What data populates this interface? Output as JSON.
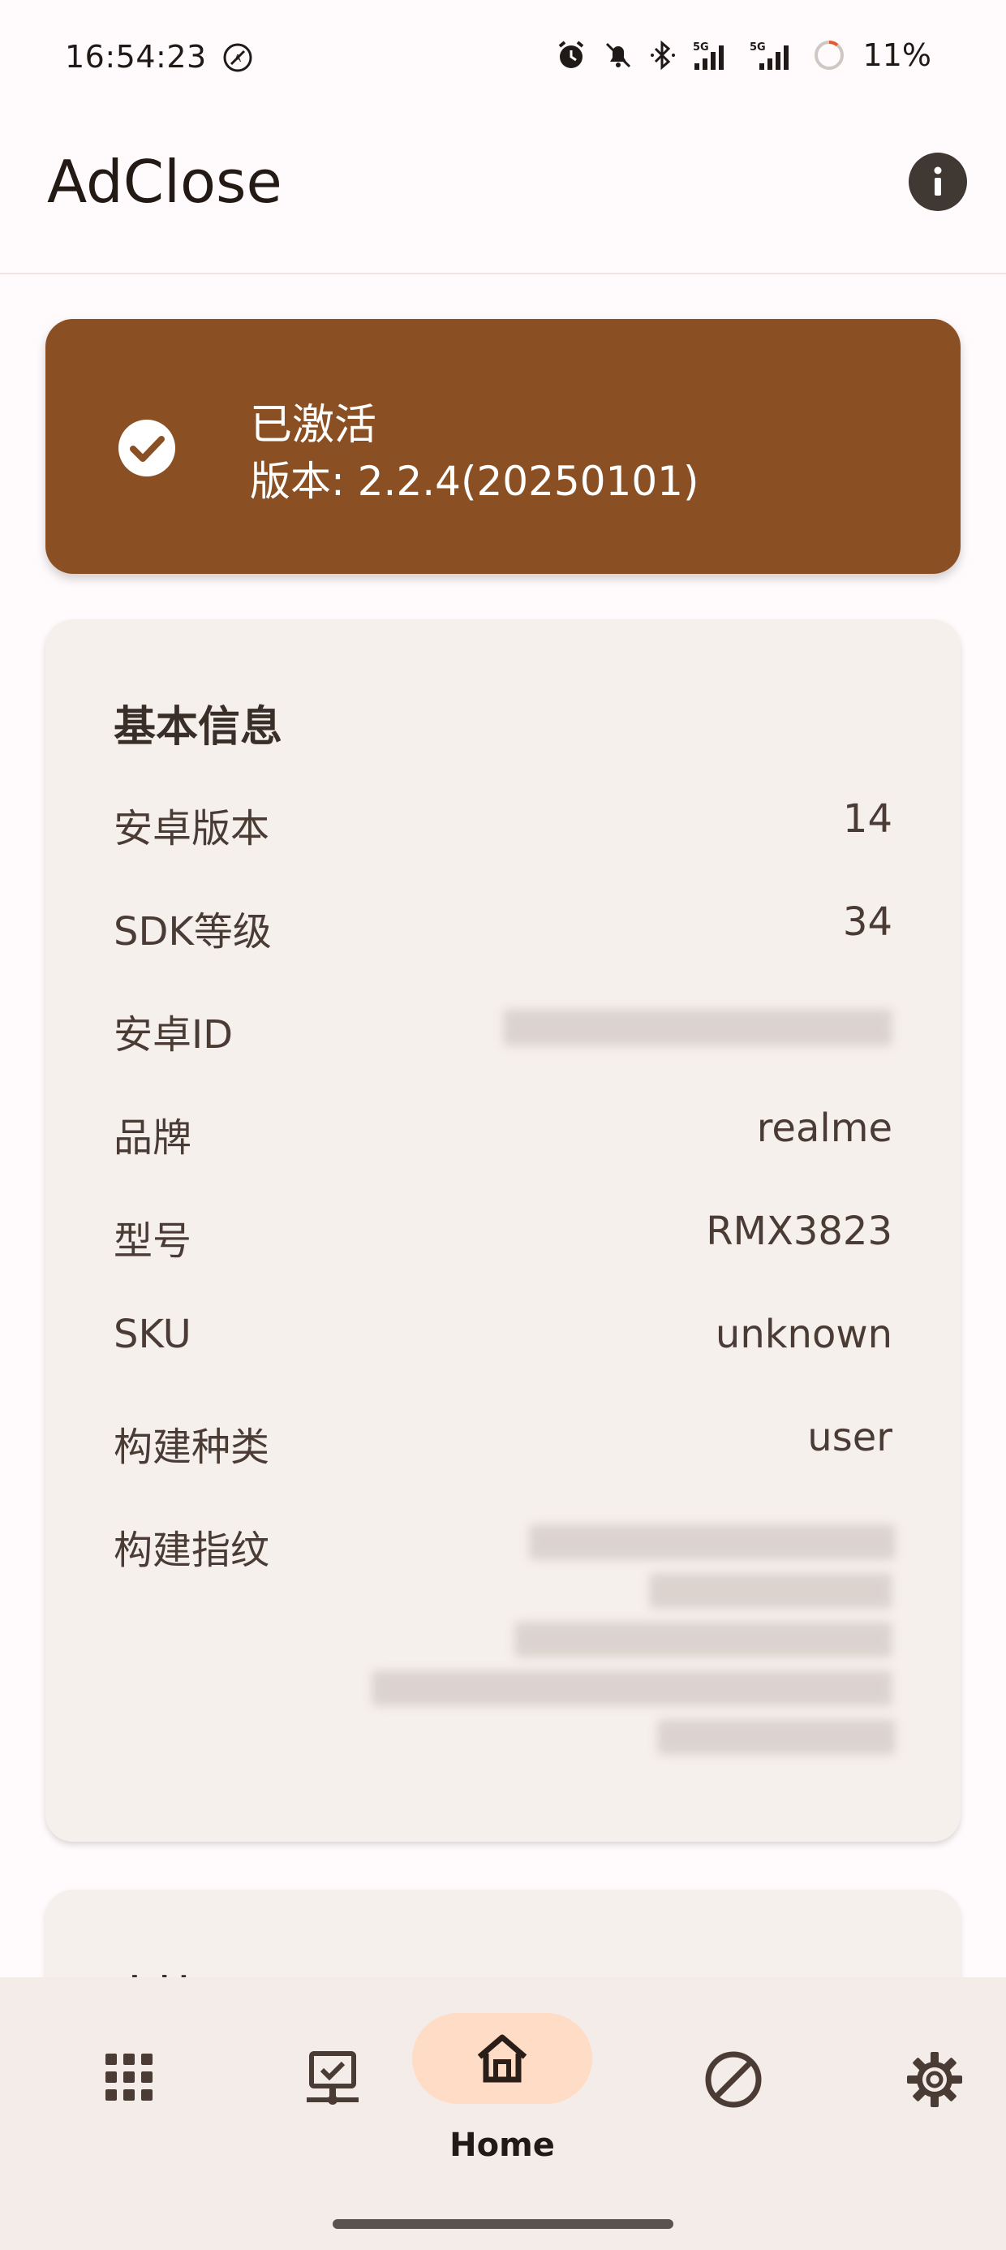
{
  "status_bar": {
    "time": "16:54:23",
    "battery": "11%",
    "net1": "5G",
    "net2": "5G",
    "icons": [
      "vpn-icon",
      "alarm-icon",
      "bell-off-icon",
      "bluetooth-icon",
      "signal-icon",
      "signal-icon",
      "battery-icon"
    ]
  },
  "app_bar": {
    "title": "AdClose",
    "info_icon": "info-icon"
  },
  "activation": {
    "status": "已激活",
    "version": "版本: 2.2.4(20250101)",
    "icon": "check-circle-icon",
    "color": "#8a5024"
  },
  "basic_info": {
    "title": "基本信息",
    "rows": [
      {
        "label": "安卓版本",
        "value": "14"
      },
      {
        "label": "SDK等级",
        "value": "34"
      },
      {
        "label": "安卓ID",
        "value": ""
      },
      {
        "label": "品牌",
        "value": "realme"
      },
      {
        "label": "型号",
        "value": "RMX3823"
      },
      {
        "label": "SKU",
        "value": "unknown"
      },
      {
        "label": "构建种类",
        "value": "user"
      },
      {
        "label": "构建指纹",
        "value": ""
      }
    ]
  },
  "next_card": {
    "title": "支持"
  },
  "bottom_nav": {
    "items": [
      {
        "icon": "apps-grid-icon"
      },
      {
        "icon": "device-check-icon"
      },
      {
        "icon": "home-icon",
        "label": "Home",
        "selected": true
      },
      {
        "icon": "block-icon"
      },
      {
        "icon": "settings-icon"
      }
    ],
    "accent": "#ffdcc6"
  }
}
